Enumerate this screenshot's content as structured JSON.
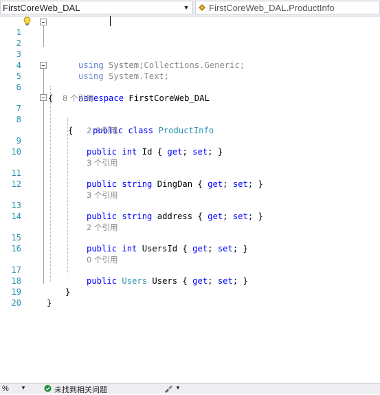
{
  "navbar": {
    "project": "FirstCoreWeb_DAL",
    "type_scope": "FirstCoreWeb_DAL.ProductInfo"
  },
  "editor": {
    "line_numbers": [
      "1",
      "2",
      "3",
      "4",
      "5",
      "6",
      "7",
      "8",
      "9",
      "10",
      "11",
      "12",
      "13",
      "14",
      "15",
      "16",
      "17",
      "18",
      "19",
      "20"
    ],
    "lines": {
      "l1": {
        "kw": "using",
        "rest": " System;"
      },
      "l2": {
        "kw": "using",
        "rest": " System.Collections.Generic;"
      },
      "l3": {
        "kw": "using",
        "rest": " System.Text;"
      },
      "l5": {
        "kw": "namespace",
        "rest": " FirstCoreWeb_DAL"
      },
      "l6": {
        "text": "{"
      },
      "lens7": "8 个引用",
      "l7": {
        "kw1": "public",
        "kw2": "class",
        "type": "ProductInfo"
      },
      "l8": {
        "text": "{"
      },
      "lens9": "2 个引用",
      "l9": {
        "kw1": "public",
        "kw2": "int",
        "name": " Id { ",
        "get": "get",
        "mid": "; ",
        "set": "set",
        "end": "; }"
      },
      "lens11": "3 个引用",
      "l11": {
        "kw1": "public",
        "kw2": "string",
        "name": " DingDan { ",
        "get": "get",
        "mid": "; ",
        "set": "set",
        "end": "; }"
      },
      "lens13": "3 个引用",
      "l13": {
        "kw1": "public",
        "kw2": "string",
        "name": " address { ",
        "get": "get",
        "mid": "; ",
        "set": "set",
        "end": "; }"
      },
      "lens15": "2 个引用",
      "l15": {
        "kw1": "public",
        "kw2": "int",
        "name": " UsersId { ",
        "get": "get",
        "mid": "; ",
        "set": "set",
        "end": "; }"
      },
      "lens17": "0 个引用",
      "l17": {
        "kw1": "public",
        "type": "Users",
        "name": " Users { ",
        "get": "get",
        "mid": "; ",
        "set": "set",
        "end": "; }"
      },
      "l18": {
        "text": "}"
      },
      "l19": {
        "text": "}"
      }
    }
  },
  "statusbar": {
    "zoom": "%",
    "issues": "未找到相关问题"
  },
  "colors": {
    "keyword": "#0000ff",
    "type": "#2b91af",
    "line_number": "#2b91af",
    "codelens": "#8a8a8a",
    "issues_ok": "#1e8e3e"
  },
  "icons": [
    "chevron-down-icon",
    "class-icon",
    "lightbulb-icon",
    "collapse-icon",
    "check-circle-icon",
    "brush-icon"
  ]
}
